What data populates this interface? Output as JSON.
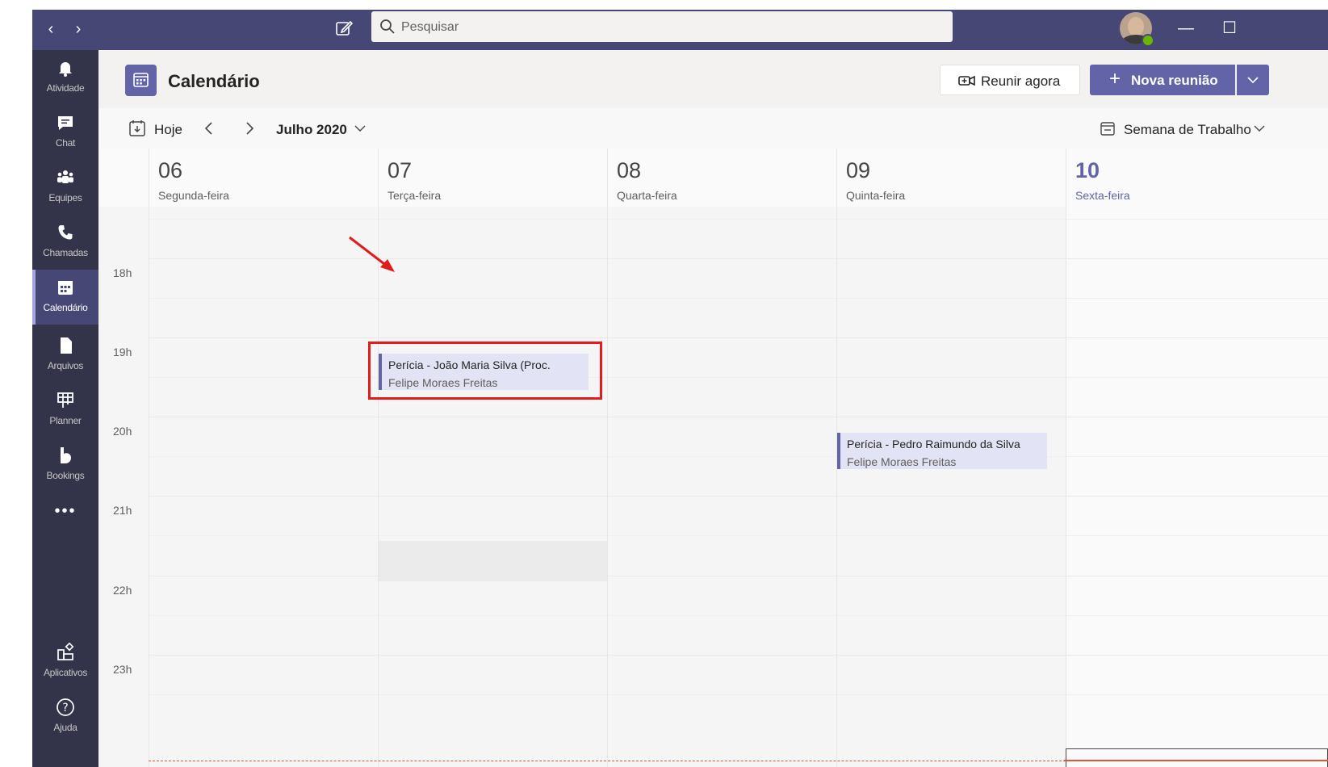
{
  "titlebar": {
    "search_placeholder": "Pesquisar"
  },
  "rail": {
    "items": [
      {
        "label": "Atividade",
        "icon": "bell-icon"
      },
      {
        "label": "Chat",
        "icon": "chat-icon"
      },
      {
        "label": "Equipes",
        "icon": "teams-icon"
      },
      {
        "label": "Chamadas",
        "icon": "phone-icon"
      },
      {
        "label": "Calendário",
        "icon": "calendar-icon",
        "active": true
      },
      {
        "label": "Arquivos",
        "icon": "file-icon"
      },
      {
        "label": "Planner",
        "icon": "planner-icon"
      },
      {
        "label": "Bookings",
        "icon": "bookings-icon"
      }
    ],
    "more": "•••",
    "bottom": [
      {
        "label": "Aplicativos",
        "icon": "apps-icon"
      },
      {
        "label": "Ajuda",
        "icon": "help-icon"
      }
    ]
  },
  "header": {
    "title": "Calendário",
    "meet_now": "Reunir agora",
    "new_meeting": "Nova reunião"
  },
  "toolbar": {
    "today": "Hoje",
    "month": "Julho 2020",
    "view": "Semana de Trabalho"
  },
  "days": [
    {
      "num": "06",
      "name": "Segunda-feira"
    },
    {
      "num": "07",
      "name": "Terça-feira"
    },
    {
      "num": "08",
      "name": "Quarta-feira"
    },
    {
      "num": "09",
      "name": "Quinta-feira"
    },
    {
      "num": "10",
      "name": "Sexta-feira",
      "today": true
    }
  ],
  "hours": [
    "18h",
    "19h",
    "20h",
    "21h",
    "22h",
    "23h"
  ],
  "events": [
    {
      "title": "Perícia - João Maria Silva (Proc.",
      "organizer": "Felipe Moraes Freitas"
    },
    {
      "title": "Perícia - Pedro Raimundo da Silva",
      "organizer": "Felipe Moraes Freitas"
    }
  ],
  "colors": {
    "accent": "#6264a7",
    "titlebar": "#464775",
    "rail": "#33344a",
    "annotation": "#e21b1b",
    "current_time": "#e8542f"
  }
}
